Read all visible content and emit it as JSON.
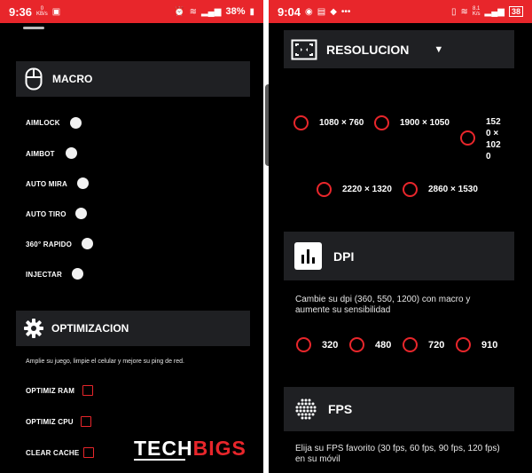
{
  "left_status": {
    "time": "9:36",
    "mini": "0\nKB/s",
    "battery": "38%"
  },
  "right_status": {
    "time": "9:04",
    "mini": "8.1\nK/s",
    "battery": "38"
  },
  "macro": {
    "title": "MACRO",
    "items": [
      "AIMLOCK",
      "AIMBOT",
      "AUTO MIRA",
      "AUTO TIRO",
      "360° RAPIDO",
      "INJECTAR"
    ]
  },
  "optim": {
    "title": "OPTIMIZACION",
    "description": "Amplie su juego, limpie el celular y mejore su ping de red.",
    "items": [
      "OPTIMIZ RAM",
      "OPTIMIZ CPU",
      "CLEAR CACHE"
    ]
  },
  "resolucion": {
    "title": "RESOLUCION",
    "options": [
      "1080 × 760",
      "1900 × 1050",
      "152\n0 ×\n102\n0",
      "2220 × 1320",
      "2860 × 1530"
    ]
  },
  "dpi": {
    "title": "DPI",
    "description": "Cambie su dpi (360, 550, 1200) con macro y aumente su sensibilidad",
    "options": [
      "320",
      "480",
      "720",
      "910"
    ]
  },
  "fps": {
    "title": "FPS",
    "description": "Elija su FPS favorito (30 fps, 60 fps, 90 fps, 120 fps) en su móvil"
  },
  "watermark": {
    "part1": "TECH",
    "part2": "BIGS"
  },
  "colors": {
    "accent": "#e8262b",
    "panel": "#1f2023",
    "background": "#000000"
  }
}
